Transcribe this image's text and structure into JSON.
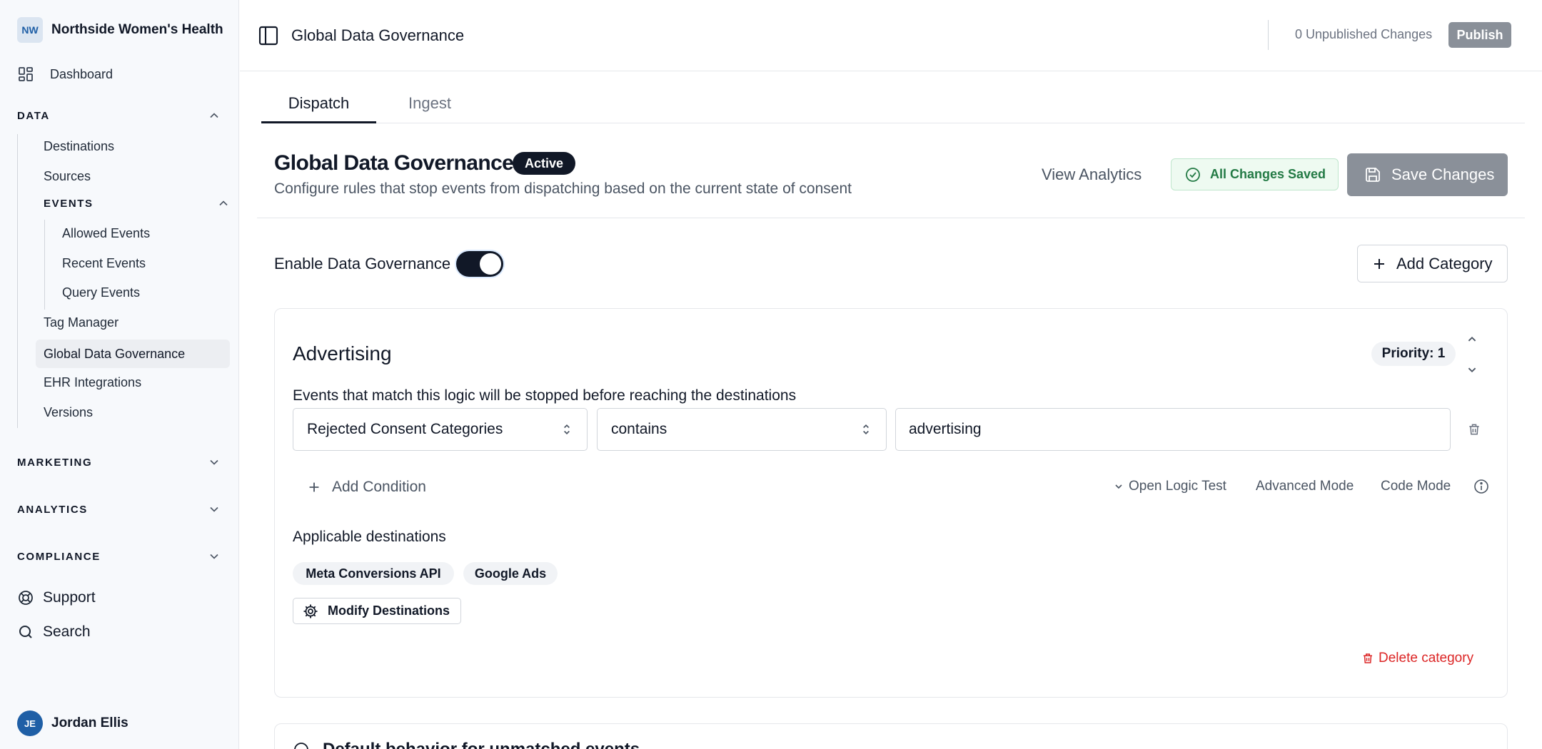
{
  "org": {
    "initials": "NW",
    "name": "Northside Women's Health"
  },
  "sidebar": {
    "dashboard": "Dashboard",
    "data": {
      "title": "DATA",
      "items": [
        "Destinations",
        "Sources"
      ],
      "events": {
        "title": "EVENTS",
        "items": [
          "Allowed Events",
          "Recent Events",
          "Query Events"
        ]
      },
      "items_after": [
        "Tag Manager",
        "Global Data Governance",
        "EHR Integrations",
        "Versions"
      ]
    },
    "marketing": "MARKETING",
    "analytics": "ANALYTICS",
    "compliance": "COMPLIANCE",
    "support": "Support",
    "search": "Search",
    "user": {
      "initials": "JE",
      "name": "Jordan Ellis"
    }
  },
  "topbar": {
    "title": "Global Data Governance",
    "unpublished": "0 Unpublished Changes",
    "publish": "Publish"
  },
  "tabs": [
    "Dispatch",
    "Ingest"
  ],
  "header": {
    "title": "Global Data Governance",
    "status": "Active",
    "subtitle": "Configure rules that stop events from dispatching based on the current state of consent",
    "view_analytics": "View Analytics",
    "saved": "All Changes Saved",
    "save": "Save Changes"
  },
  "enable": {
    "label": "Enable Data Governance",
    "on": true
  },
  "add_category": "Add Category",
  "category": {
    "name": "Advertising",
    "priority": "Priority: 1",
    "logic_label": "Events that match this logic will be stopped before reaching the destinations",
    "condition": {
      "field": "Rejected Consent Categories",
      "operator": "contains",
      "value": "advertising"
    },
    "add_condition": "Add Condition",
    "open_logic_test": "Open Logic Test",
    "advanced_mode": "Advanced Mode",
    "code_mode": "Code Mode",
    "destinations_label": "Applicable destinations",
    "destinations": [
      "Meta Conversions API",
      "Google Ads"
    ],
    "modify_destinations": "Modify Destinations",
    "delete": "Delete category"
  },
  "default_behavior": {
    "title": "Default behavior for unmatched events"
  },
  "colors": {
    "primary": "#111827",
    "muted_button": "#8a9099",
    "success_text": "#237a45",
    "success_bg": "#eefaf1",
    "danger": "#dc2626",
    "sidebar_bg": "#f7f9fc"
  }
}
